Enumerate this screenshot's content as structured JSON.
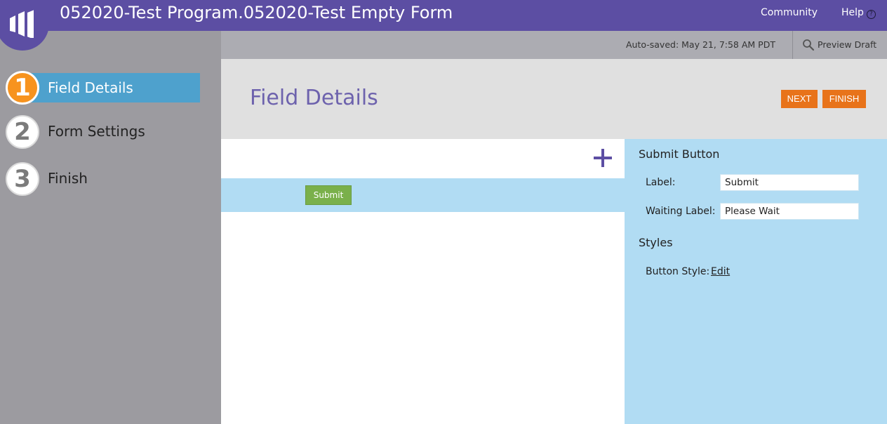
{
  "header": {
    "title": "052020-Test Program.052020-Test Empty Form",
    "nav": {
      "community": "Community",
      "help": "Help"
    },
    "help_icon": "?"
  },
  "sidebar": {
    "steps": [
      {
        "number": "1",
        "label": "Field Details",
        "active": true
      },
      {
        "number": "2",
        "label": "Form Settings",
        "active": false
      },
      {
        "number": "3",
        "label": "Finish",
        "active": false
      }
    ]
  },
  "save_bar": {
    "autosaved": "Auto-saved: May 21, 7:58 AM PDT",
    "preview_draft": "Preview Draft"
  },
  "main": {
    "title": "Field Details",
    "next_label": "NEXT",
    "finish_label": "FINISH",
    "form_submit_label": "Submit"
  },
  "properties": {
    "submit_button_title": "Submit Button",
    "label_label": "Label:",
    "label_value": "Submit",
    "waiting_label_label": "Waiting Label:",
    "waiting_label_value": "Please Wait",
    "styles_title": "Styles",
    "button_style_label": "Button Style:",
    "edit_label": "Edit"
  },
  "colors": {
    "brand_purple": "#5c4ea3",
    "active_step_blue": "#4ea1cd",
    "step_orange": "#f7931e",
    "action_orange": "#e8731a",
    "panel_blue": "#b1dcf3",
    "submit_green": "#7ab04b"
  },
  "icons": {
    "logo": "marketo-logo-icon",
    "help": "question-circle-icon",
    "preview": "magnifier-icon",
    "add": "plus-icon"
  }
}
